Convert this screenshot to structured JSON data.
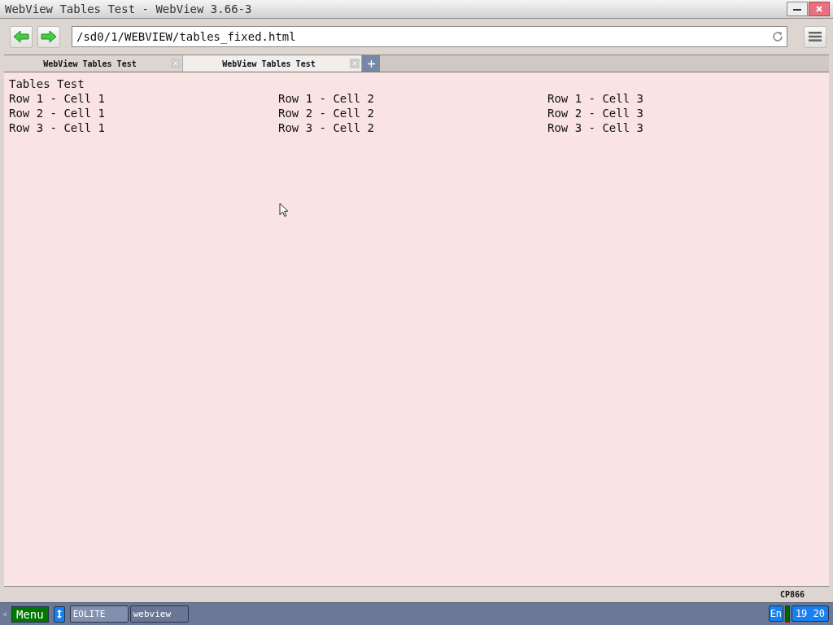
{
  "window": {
    "title": "WebView Tables Test - WebView 3.66-3"
  },
  "toolbar": {
    "address": "/sd0/1/WEBVIEW/tables_fixed.html"
  },
  "tabs": [
    {
      "label": "WebView Tables Test",
      "selected": false
    },
    {
      "label": "WebView Tables Test",
      "selected": true
    }
  ],
  "page": {
    "heading": "Tables Test",
    "table": {
      "rows": [
        [
          "Row 1 - Cell 1",
          "Row 1 - Cell 2",
          "Row 1 - Cell 3"
        ],
        [
          "Row 2 - Cell 1",
          "Row 2 - Cell 2",
          "Row 2 - Cell 3"
        ],
        [
          "Row 3 - Cell 1",
          "Row 3 - Cell 2",
          "Row 3 - Cell 3"
        ]
      ]
    }
  },
  "status_bar": {
    "encoding": "CP866"
  },
  "taskbar": {
    "menu": "Menu",
    "tasks": [
      {
        "label": "EOLITE",
        "selected": true
      },
      {
        "label": "webview",
        "selected": false
      }
    ],
    "language": "En",
    "clock": "19 20"
  }
}
